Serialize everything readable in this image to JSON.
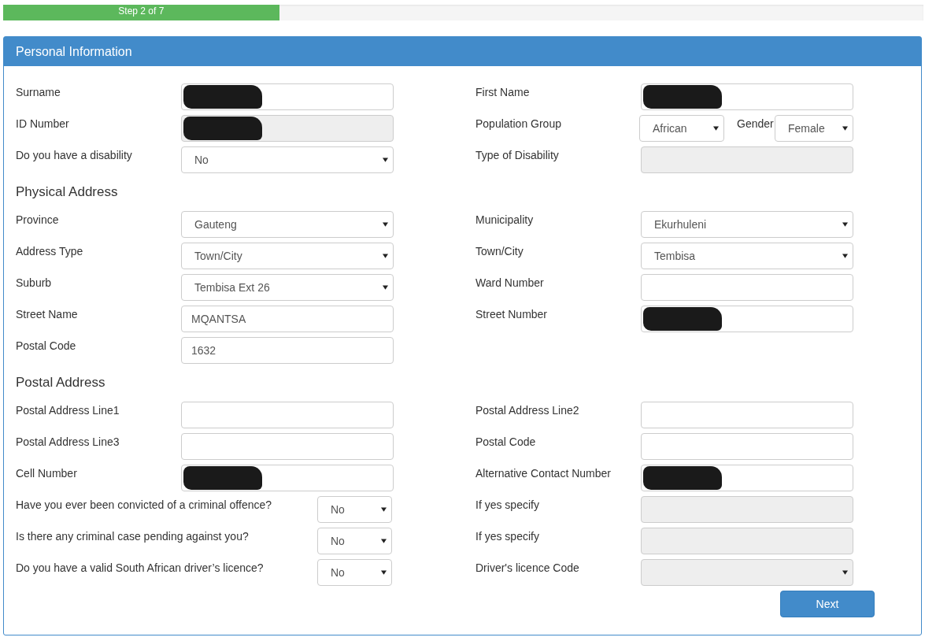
{
  "progress": {
    "label": "Step 2 of 7",
    "level": 0.3
  },
  "panel": {
    "title": "Personal Information"
  },
  "rows": [
    {
      "kind": "fields",
      "cells": [
        {
          "kind": "normal",
          "label": "Surname",
          "control": {
            "kind": "input",
            "redacted": true
          }
        },
        {
          "kind": "normal",
          "label": "First Name",
          "control": {
            "kind": "input",
            "redacted": true
          }
        }
      ]
    },
    {
      "kind": "fields",
      "cells": [
        {
          "kind": "normal",
          "label": "ID Number",
          "control": {
            "kind": "readonly",
            "redacted": true
          }
        },
        {
          "kind": "pair",
          "label": "Population Group",
          "control": {
            "kind": "select",
            "value": "African"
          },
          "label2": "Gender",
          "control2": {
            "kind": "select",
            "value": "Female"
          }
        }
      ]
    },
    {
      "kind": "fields",
      "cells": [
        {
          "kind": "normal",
          "label": "Do you have a disability",
          "control": {
            "kind": "select",
            "value": "No"
          }
        },
        {
          "kind": "normal",
          "label": "Type of Disability",
          "control": {
            "kind": "readonly"
          }
        }
      ]
    },
    {
      "kind": "heading",
      "text": "Physical Address"
    },
    {
      "kind": "fields",
      "cells": [
        {
          "kind": "normal",
          "label": "Province",
          "control": {
            "kind": "select",
            "value": "Gauteng"
          }
        },
        {
          "kind": "normal",
          "label": "Municipality",
          "control": {
            "kind": "select",
            "value": "Ekurhuleni"
          }
        }
      ]
    },
    {
      "kind": "fields",
      "cells": [
        {
          "kind": "normal",
          "label": "Address Type",
          "control": {
            "kind": "select",
            "value": "Town/City"
          }
        },
        {
          "kind": "normal",
          "label": "Town/City",
          "control": {
            "kind": "select",
            "value": "Tembisa"
          }
        }
      ]
    },
    {
      "kind": "fields",
      "cells": [
        {
          "kind": "normal",
          "label": "Suburb",
          "control": {
            "kind": "select",
            "value": "Tembisa Ext 26"
          }
        },
        {
          "kind": "normal",
          "label": "Ward Number",
          "control": {
            "kind": "input"
          }
        }
      ]
    },
    {
      "kind": "fields",
      "cells": [
        {
          "kind": "normal",
          "label": "Street Name",
          "control": {
            "kind": "input",
            "value": "MQANTSA"
          }
        },
        {
          "kind": "normal",
          "label": "Street Number",
          "control": {
            "kind": "input",
            "redacted": true
          }
        }
      ]
    },
    {
      "kind": "fields",
      "cells": [
        {
          "kind": "normal",
          "label": "Postal Code",
          "control": {
            "kind": "input",
            "value": "1632"
          }
        }
      ]
    },
    {
      "kind": "heading",
      "text": "Postal Address"
    },
    {
      "kind": "fields",
      "cells": [
        {
          "kind": "normal",
          "label": "Postal Address Line1",
          "control": {
            "kind": "input"
          }
        },
        {
          "kind": "normal",
          "label": "Postal Address Line2",
          "control": {
            "kind": "input"
          }
        }
      ]
    },
    {
      "kind": "fields",
      "cells": [
        {
          "kind": "normal",
          "label": "Postal Address Line3",
          "control": {
            "kind": "input"
          }
        },
        {
          "kind": "normal",
          "label": "Postal Code",
          "control": {
            "kind": "input"
          }
        }
      ]
    },
    {
      "kind": "fields",
      "cells": [
        {
          "kind": "normal",
          "label": "Cell Number",
          "control": {
            "kind": "input",
            "redacted": true
          }
        },
        {
          "kind": "normal",
          "label": "Alternative Contact Number",
          "control": {
            "kind": "input",
            "redacted": true
          }
        }
      ]
    },
    {
      "kind": "fields",
      "cells": [
        {
          "kind": "question",
          "label": "Have you ever been convicted of a criminal offence?",
          "control": {
            "kind": "select",
            "value": "No"
          }
        },
        {
          "kind": "normal",
          "label": "If yes specify",
          "control": {
            "kind": "readonly"
          }
        }
      ]
    },
    {
      "kind": "fields",
      "cells": [
        {
          "kind": "question",
          "label": "Is there any criminal case pending against you?",
          "control": {
            "kind": "select",
            "value": "No"
          }
        },
        {
          "kind": "normal",
          "label": "If yes specify",
          "control": {
            "kind": "readonly"
          }
        }
      ]
    },
    {
      "kind": "fields",
      "cells": [
        {
          "kind": "question",
          "label": "Do you have a valid South African driver’s licence?",
          "control": {
            "kind": "select",
            "value": "No"
          }
        },
        {
          "kind": "normal",
          "label": "Driver's licence Code",
          "control": {
            "kind": "readonly-select"
          }
        }
      ]
    }
  ],
  "next_button": "Next"
}
